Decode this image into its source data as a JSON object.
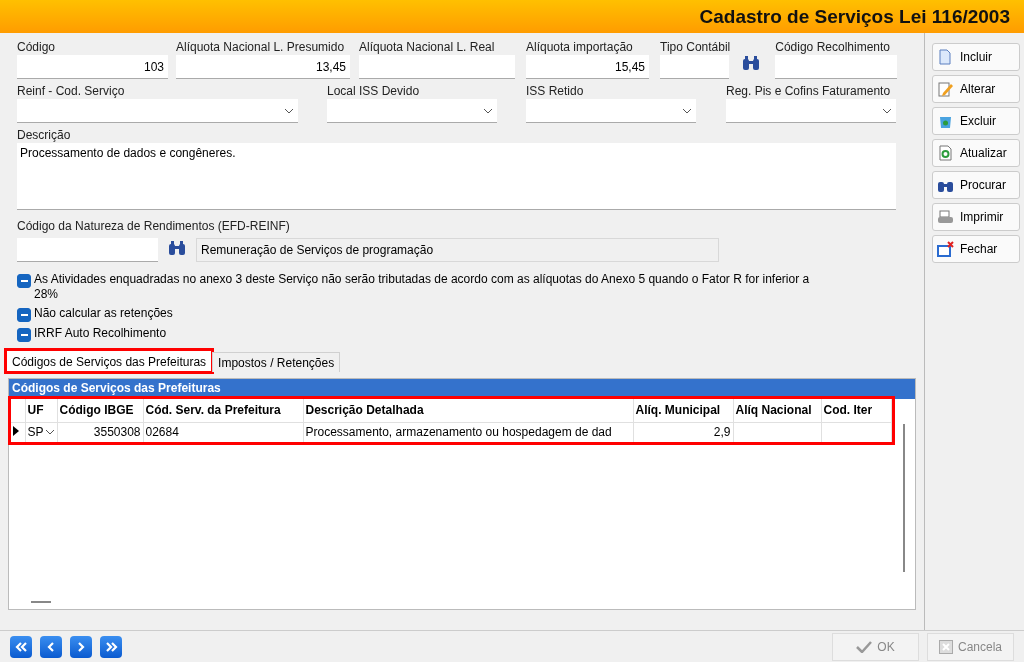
{
  "window": {
    "title": "Cadastro de Serviços Lei 116/2003"
  },
  "row1": [
    {
      "label": "Código",
      "value": "103",
      "kind": "text"
    },
    {
      "label": "Alíquota Nacional L. Presumido",
      "value": "13,45",
      "kind": "text"
    },
    {
      "label": "Alíquota Nacional L. Real",
      "kind": "text"
    },
    {
      "label": "Alíquota importação",
      "value": "15,45",
      "kind": "text"
    },
    {
      "label": "Tipo Contábil",
      "kind": "lookup"
    },
    {
      "label": "Código Recolhimento",
      "kind": "text"
    }
  ],
  "row2": [
    {
      "label": "Reinf - Cod. Serviço"
    },
    {
      "label": "Local ISS Devido"
    },
    {
      "label": "ISS Retido"
    },
    {
      "label": "Reg. Pis e Cofins Faturamento"
    }
  ],
  "description": {
    "label": "Descrição",
    "value": "Processamento de dados e congêneres."
  },
  "natureza": {
    "label": "Código da Natureza de Rendimentos (EFD-REINF)",
    "name": "Remuneração de Serviços de programação"
  },
  "checkboxes": [
    {
      "label": "As Atividades enquadradas no anexo 3 deste Serviço não serão tributadas de acordo com as alíquotas do Anexo 5 quando o Fator R for inferior a 28%",
      "checked": true
    },
    {
      "label": "Não calcular as retenções",
      "checked": true
    },
    {
      "label": "IRRF Auto Recolhimento",
      "checked": true
    }
  ],
  "tabs": [
    {
      "label": "Códigos de Serviços das Prefeituras",
      "selected": true,
      "highlighted": true
    },
    {
      "label": "Impostos / Retenções",
      "selected": false,
      "highlighted": false
    }
  ],
  "grid": {
    "title": "Códigos de Serviços das Prefeituras",
    "highlighted": true,
    "columns": [
      "UF",
      "Código IBGE",
      "Cód. Serv. da Prefeitura",
      "Descrição Detalhada",
      "Alíq. Municipal",
      "Alíq Nacional",
      "Cod. Iter"
    ],
    "rows": [
      {
        "selected": true,
        "cells": [
          "SP",
          "3550308",
          "02684",
          "Processamento, armazenamento ou hospedagem de dad",
          "2,9",
          "",
          ""
        ]
      }
    ]
  },
  "actions": [
    {
      "label": "Incluir",
      "kind": "new"
    },
    {
      "label": "Alterar",
      "kind": "edit"
    },
    {
      "label": "Excluir",
      "kind": "delete"
    },
    {
      "label": "Atualizar",
      "kind": "refresh"
    },
    {
      "label": "Procurar",
      "kind": "search"
    },
    {
      "label": "Imprimir",
      "kind": "print"
    },
    {
      "label": "Fechar",
      "kind": "close"
    }
  ],
  "navigation": [
    {
      "kind": "first"
    },
    {
      "kind": "prev"
    },
    {
      "kind": "next"
    },
    {
      "kind": "last"
    }
  ],
  "footer_buttons": [
    {
      "label": "OK",
      "kind": "ok",
      "disabled": true
    },
    {
      "label": "Cancela",
      "kind": "cancel",
      "disabled": true
    }
  ]
}
